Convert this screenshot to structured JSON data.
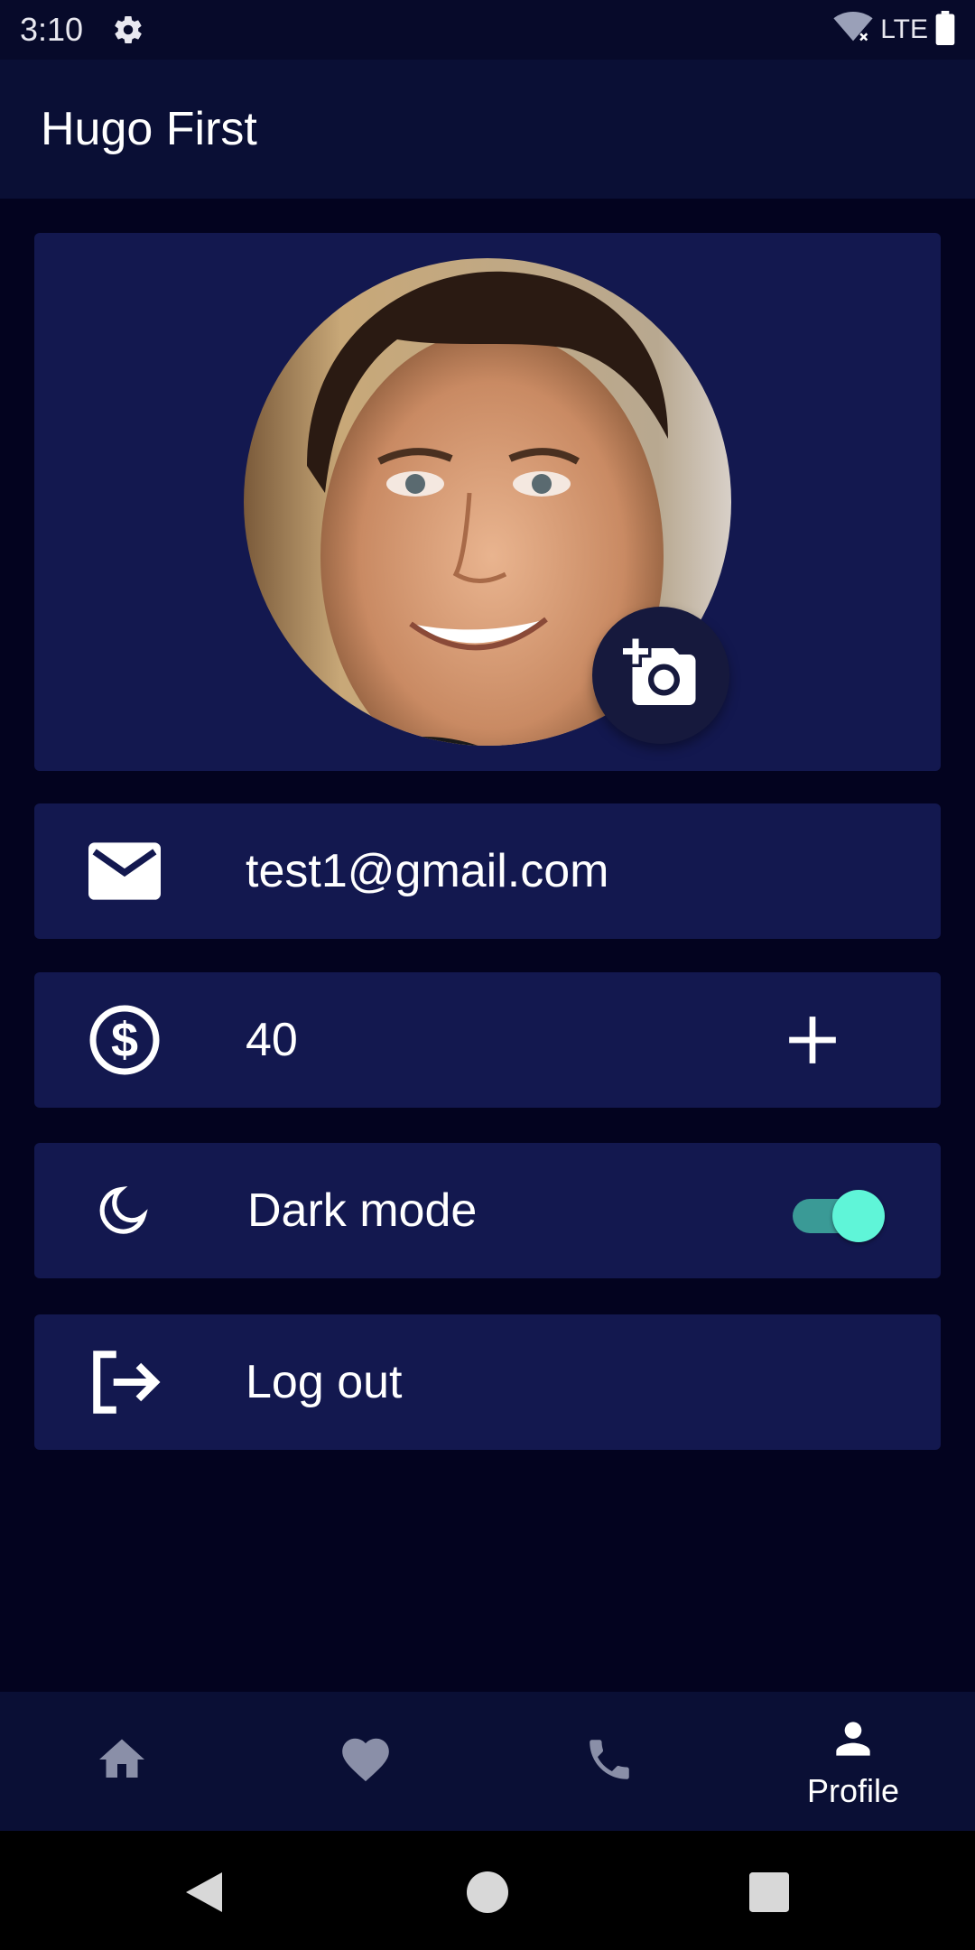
{
  "status_bar": {
    "time": "3:10",
    "network": "LTE",
    "icons": [
      "gear-icon",
      "wifi-off-icon",
      "battery-icon"
    ]
  },
  "app_bar": {
    "title": "Hugo First"
  },
  "profile": {
    "avatar_icon": "user-photo",
    "camera_button_icon": "add-photo-icon"
  },
  "email_row": {
    "icon": "email-icon",
    "value": "test1@gmail.com"
  },
  "balance_row": {
    "icon": "dollar-icon",
    "value": "40",
    "action_icon": "plus-icon"
  },
  "dark_mode_row": {
    "icon": "moon-icon",
    "label": "Dark mode",
    "enabled": true
  },
  "logout_row": {
    "icon": "logout-icon",
    "label": "Log out"
  },
  "bottom_nav": {
    "items": [
      {
        "icon": "home-icon",
        "label": ""
      },
      {
        "icon": "heart-icon",
        "label": ""
      },
      {
        "icon": "phone-icon",
        "label": ""
      },
      {
        "icon": "person-icon",
        "label": "Profile"
      }
    ],
    "active_index": 3
  },
  "colors": {
    "background": "#03031f",
    "card": "#13184f",
    "app_bar": "#0a0f35",
    "accent": "#5ff5d8",
    "inactive_icon": "#8a8fa8"
  }
}
